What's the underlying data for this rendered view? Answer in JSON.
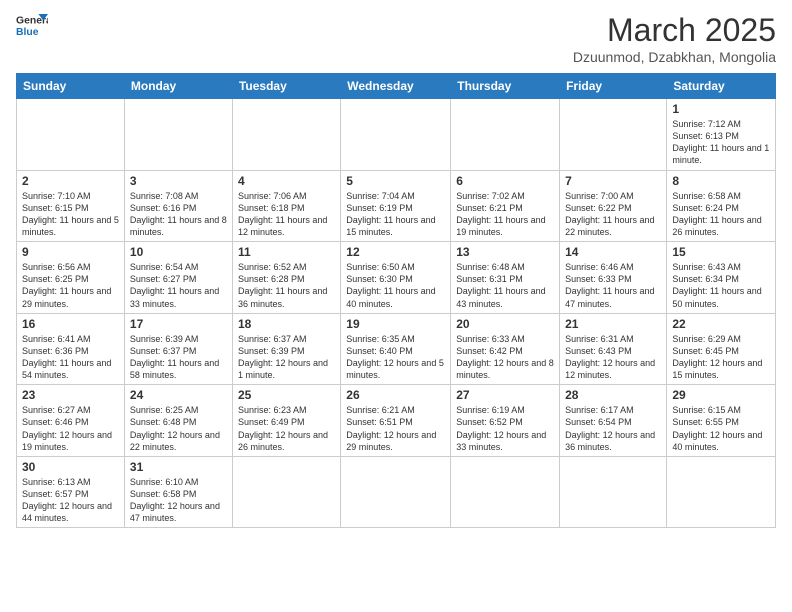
{
  "logo": {
    "line1": "General",
    "line2": "Blue"
  },
  "title": "March 2025",
  "subtitle": "Dzuunmod, Dzabkhan, Mongolia",
  "days_of_week": [
    "Sunday",
    "Monday",
    "Tuesday",
    "Wednesday",
    "Thursday",
    "Friday",
    "Saturday"
  ],
  "weeks": [
    [
      {
        "day": "",
        "info": ""
      },
      {
        "day": "",
        "info": ""
      },
      {
        "day": "",
        "info": ""
      },
      {
        "day": "",
        "info": ""
      },
      {
        "day": "",
        "info": ""
      },
      {
        "day": "",
        "info": ""
      },
      {
        "day": "1",
        "info": "Sunrise: 7:12 AM\nSunset: 6:13 PM\nDaylight: 11 hours and 1 minute."
      }
    ],
    [
      {
        "day": "2",
        "info": "Sunrise: 7:10 AM\nSunset: 6:15 PM\nDaylight: 11 hours and 5 minutes."
      },
      {
        "day": "3",
        "info": "Sunrise: 7:08 AM\nSunset: 6:16 PM\nDaylight: 11 hours and 8 minutes."
      },
      {
        "day": "4",
        "info": "Sunrise: 7:06 AM\nSunset: 6:18 PM\nDaylight: 11 hours and 12 minutes."
      },
      {
        "day": "5",
        "info": "Sunrise: 7:04 AM\nSunset: 6:19 PM\nDaylight: 11 hours and 15 minutes."
      },
      {
        "day": "6",
        "info": "Sunrise: 7:02 AM\nSunset: 6:21 PM\nDaylight: 11 hours and 19 minutes."
      },
      {
        "day": "7",
        "info": "Sunrise: 7:00 AM\nSunset: 6:22 PM\nDaylight: 11 hours and 22 minutes."
      },
      {
        "day": "8",
        "info": "Sunrise: 6:58 AM\nSunset: 6:24 PM\nDaylight: 11 hours and 26 minutes."
      }
    ],
    [
      {
        "day": "9",
        "info": "Sunrise: 6:56 AM\nSunset: 6:25 PM\nDaylight: 11 hours and 29 minutes."
      },
      {
        "day": "10",
        "info": "Sunrise: 6:54 AM\nSunset: 6:27 PM\nDaylight: 11 hours and 33 minutes."
      },
      {
        "day": "11",
        "info": "Sunrise: 6:52 AM\nSunset: 6:28 PM\nDaylight: 11 hours and 36 minutes."
      },
      {
        "day": "12",
        "info": "Sunrise: 6:50 AM\nSunset: 6:30 PM\nDaylight: 11 hours and 40 minutes."
      },
      {
        "day": "13",
        "info": "Sunrise: 6:48 AM\nSunset: 6:31 PM\nDaylight: 11 hours and 43 minutes."
      },
      {
        "day": "14",
        "info": "Sunrise: 6:46 AM\nSunset: 6:33 PM\nDaylight: 11 hours and 47 minutes."
      },
      {
        "day": "15",
        "info": "Sunrise: 6:43 AM\nSunset: 6:34 PM\nDaylight: 11 hours and 50 minutes."
      }
    ],
    [
      {
        "day": "16",
        "info": "Sunrise: 6:41 AM\nSunset: 6:36 PM\nDaylight: 11 hours and 54 minutes."
      },
      {
        "day": "17",
        "info": "Sunrise: 6:39 AM\nSunset: 6:37 PM\nDaylight: 11 hours and 58 minutes."
      },
      {
        "day": "18",
        "info": "Sunrise: 6:37 AM\nSunset: 6:39 PM\nDaylight: 12 hours and 1 minute."
      },
      {
        "day": "19",
        "info": "Sunrise: 6:35 AM\nSunset: 6:40 PM\nDaylight: 12 hours and 5 minutes."
      },
      {
        "day": "20",
        "info": "Sunrise: 6:33 AM\nSunset: 6:42 PM\nDaylight: 12 hours and 8 minutes."
      },
      {
        "day": "21",
        "info": "Sunrise: 6:31 AM\nSunset: 6:43 PM\nDaylight: 12 hours and 12 minutes."
      },
      {
        "day": "22",
        "info": "Sunrise: 6:29 AM\nSunset: 6:45 PM\nDaylight: 12 hours and 15 minutes."
      }
    ],
    [
      {
        "day": "23",
        "info": "Sunrise: 6:27 AM\nSunset: 6:46 PM\nDaylight: 12 hours and 19 minutes."
      },
      {
        "day": "24",
        "info": "Sunrise: 6:25 AM\nSunset: 6:48 PM\nDaylight: 12 hours and 22 minutes."
      },
      {
        "day": "25",
        "info": "Sunrise: 6:23 AM\nSunset: 6:49 PM\nDaylight: 12 hours and 26 minutes."
      },
      {
        "day": "26",
        "info": "Sunrise: 6:21 AM\nSunset: 6:51 PM\nDaylight: 12 hours and 29 minutes."
      },
      {
        "day": "27",
        "info": "Sunrise: 6:19 AM\nSunset: 6:52 PM\nDaylight: 12 hours and 33 minutes."
      },
      {
        "day": "28",
        "info": "Sunrise: 6:17 AM\nSunset: 6:54 PM\nDaylight: 12 hours and 36 minutes."
      },
      {
        "day": "29",
        "info": "Sunrise: 6:15 AM\nSunset: 6:55 PM\nDaylight: 12 hours and 40 minutes."
      }
    ],
    [
      {
        "day": "30",
        "info": "Sunrise: 6:13 AM\nSunset: 6:57 PM\nDaylight: 12 hours and 44 minutes."
      },
      {
        "day": "31",
        "info": "Sunrise: 6:10 AM\nSunset: 6:58 PM\nDaylight: 12 hours and 47 minutes."
      },
      {
        "day": "",
        "info": ""
      },
      {
        "day": "",
        "info": ""
      },
      {
        "day": "",
        "info": ""
      },
      {
        "day": "",
        "info": ""
      },
      {
        "day": "",
        "info": ""
      }
    ]
  ]
}
